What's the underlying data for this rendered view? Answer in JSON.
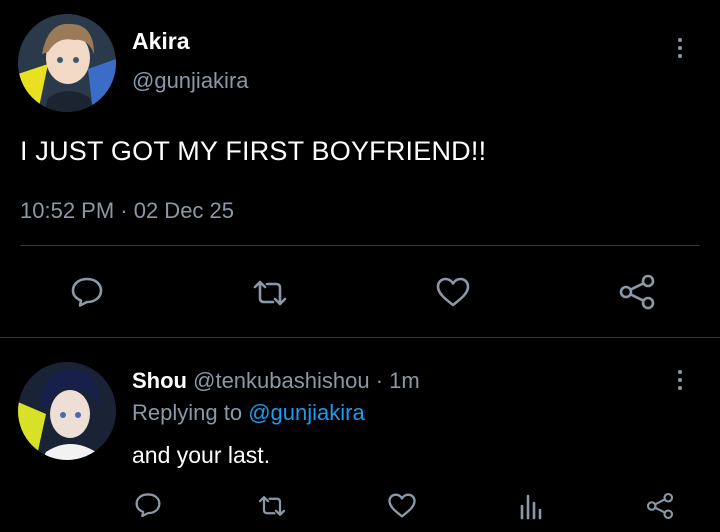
{
  "main_tweet": {
    "author_name": "Akira",
    "author_handle": "@gunjiakira",
    "text": "I JUST GOT MY FIRST BOYFRIEND!!",
    "timestamp": "10:52 PM · 02 Dec 25",
    "actions": [
      "reply-icon",
      "retweet-icon",
      "like-icon",
      "share-icon"
    ],
    "colors": {
      "background": "#000000",
      "secondary_text": "#8b98a5",
      "divider": "#2f3336"
    }
  },
  "reply": {
    "author_name": "Shou",
    "author_handle": "@tenkubashishou",
    "time_ago": "· 1m",
    "replying_prefix": "Replying to",
    "replying_handle": "@gunjiakira",
    "text": "and your last.",
    "actions": [
      "reply-icon",
      "retweet-icon",
      "like-icon",
      "analytics-icon",
      "share-icon"
    ],
    "colors": {
      "link": "#1d9bf0"
    }
  }
}
